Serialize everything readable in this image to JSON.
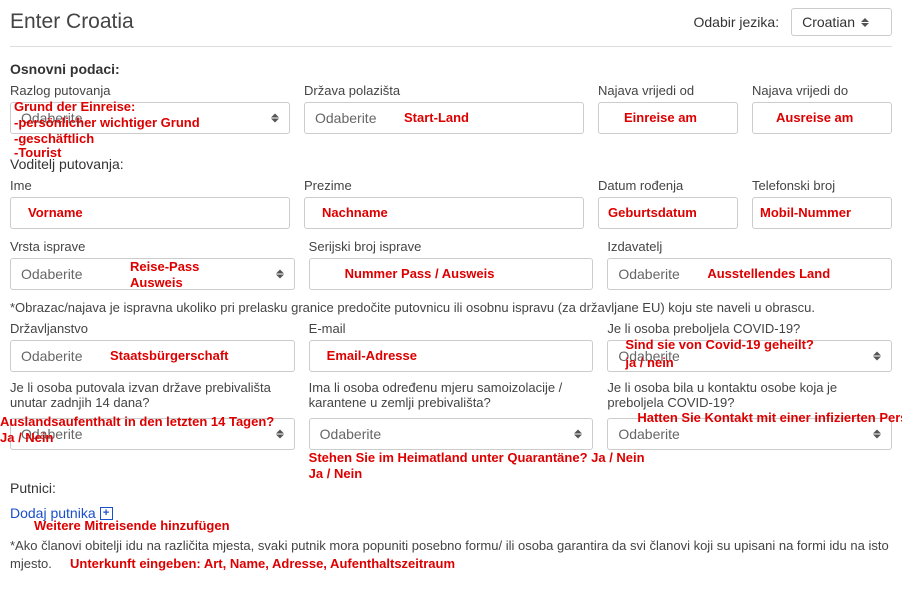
{
  "header": {
    "title": "Enter Croatia",
    "lang_label": "Odabir jezika:",
    "lang_value": "Croatian"
  },
  "sections": {
    "osnovni": "Osnovni podaci:",
    "voditelj": "Voditelj putovanja:",
    "putnici": "Putnici:"
  },
  "labels": {
    "razlog": "Razlog putovanja",
    "drzava_polazista": "Država polazišta",
    "najava_od": "Najava vrijedi od",
    "najava_do": "Najava vrijedi do",
    "ime": "Ime",
    "prezime": "Prezime",
    "datum_rodenja": "Datum rođenja",
    "telefon": "Telefonski broj",
    "vrsta_isprave": "Vrsta isprave",
    "serijski": "Serijski broj isprave",
    "izdavatelj": "Izdavatelj",
    "drzavljanstvo": "Državljanstvo",
    "email": "E-mail",
    "preboljela": "Je li osoba preboljela COVID-19?",
    "putovala": "Je li osoba putovala izvan države prebivališta unutar zadnjih 14 dana?",
    "samoizolacija": "Ima li osoba određenu mjeru samoizolacije / karantene u zemlji prebivališta?",
    "kontakt": "Je li osoba bila u kontaktu osobe koja je preboljela COVID-19?"
  },
  "ph": {
    "odaberite": "Odaberite"
  },
  "notes": {
    "obrazac": "*Obrazac/najava je ispravna ukoliko pri prelasku granice predočite putovnicu ili osobnu ispravu (za državljane EU) koju ste naveli u obrascu.",
    "dodaj": "Dodaj putnika",
    "clanovi": "*Ako članovi obitelji idu na različita mjesta, svaki putnik mora popuniti posebno formu/ ili osoba garantira da svi članovi koji su upisani na formi idu na isto mjesto."
  },
  "annotations": {
    "grund": "Grund der Einreise:",
    "grund1": "-persönlicher wichtiger Grund",
    "grund2": "-geschäftlich",
    "grund3": "-Tourist",
    "start_land": "Start-Land",
    "einreise": "Einreise am",
    "ausreise": "Ausreise am",
    "vorname": "Vorname",
    "nachname": "Nachname",
    "geburt": "Geburtsdatum",
    "mobil": "Mobil-Nummer",
    "reisepass": "Reise-Pass",
    "ausweis": "Ausweis",
    "nummer_pass": "Nummer Pass / Ausweis",
    "ausstellend": "Ausstellendes Land",
    "staats": "Staatsbürgerschaft",
    "email_adr": "Email-Adresse",
    "covid_heil": "Sind sie von Covid-19 geheilt?",
    "janein": "ja / nein",
    "ausland": "Auslandsaufenthalt in den letzten 14 Tagen?",
    "janein2": "Ja / Nein",
    "quarant": "Stehen Sie im Heimatland unter Quarantäne?  Ja / Nein",
    "janein3": "Ja / Nein",
    "kontakt_inf": "Hatten Sie Kontakt mit einer infizierten Person?",
    "weitere": "Weitere Mitreisende hinzufügen",
    "unterkunft": "Unterkunft eingeben: Art, Name, Adresse, Aufenthaltszeitraum"
  }
}
